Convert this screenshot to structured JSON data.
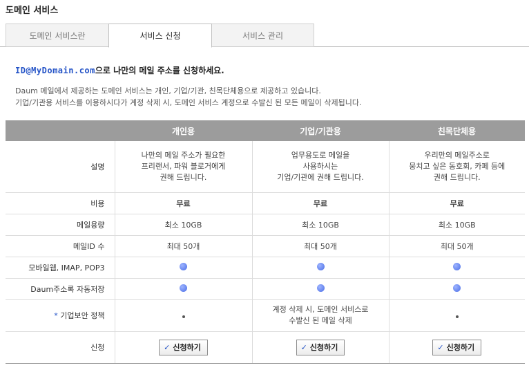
{
  "page_title": "도메인 서비스",
  "tabs": [
    {
      "label": "도메인 서비스란"
    },
    {
      "label": "서비스 신청"
    },
    {
      "label": "서비스 관리"
    }
  ],
  "intro": {
    "domain": "ID@MyDomain.com",
    "text": "으로 나만의 메일 주소를 신청하세요."
  },
  "description": {
    "line1": "Daum 메일에서 제공하는 도메인 서비스는 개인, 기업/기관, 친목단체용으로 제공하고 있습니다.",
    "line2": "기업/기관용 서비스를 이용하시다가 계정 삭제 시, 도메인 서비스 계정으로 수발신 된 모든 메일이 삭제됩니다."
  },
  "table": {
    "headers": [
      "",
      "개인용",
      "기업/기관용",
      "친목단체용"
    ],
    "rows": {
      "description": {
        "label": "설명",
        "personal": [
          "나만의 메일 주소가 필요한",
          "프리랜서, 파워 블로거에게",
          "권해 드립니다."
        ],
        "business": [
          "업무용도로 메일을",
          "사용하시는",
          "기업/기관에 권해 드립니다."
        ],
        "club": [
          "우리만의 메일주소로",
          "뭉치고 싶은 동호회, 카페 등에",
          "권해 드립니다."
        ]
      },
      "cost": {
        "label": "비용",
        "values": [
          "무료",
          "무료",
          "무료"
        ]
      },
      "capacity": {
        "label": "메일용량",
        "values": [
          "최소 10GB",
          "최소 10GB",
          "최소 10GB"
        ]
      },
      "max_ids": {
        "label": "메일ID 수",
        "values": [
          "최대 50개",
          "최대 50개",
          "최대 50개"
        ]
      },
      "mobile": {
        "label": "모바일웹, IMAP, POP3",
        "supported": [
          true,
          true,
          true
        ]
      },
      "addressbook": {
        "label": "Daum주소록 자동저장",
        "supported": [
          true,
          true,
          true
        ]
      },
      "security": {
        "label_star": "*",
        "label": "기업보안 정책",
        "business": [
          "계정 삭제 시, 도메인 서비스로",
          "수발신 된 메일 삭제"
        ]
      },
      "apply": {
        "label": "신청",
        "button_check": "✓",
        "button_label": "신청하기"
      }
    }
  },
  "colors": {
    "header_bg": "#9c9c9c",
    "accent_blue": "#2554c7",
    "warning_red": "#e04a3a",
    "bullet_blue": "#4a6ee6"
  },
  "icons": {
    "check": "checkmark-icon",
    "supported": "blue-dot-icon",
    "not_applicable": "small-dot-icon"
  }
}
